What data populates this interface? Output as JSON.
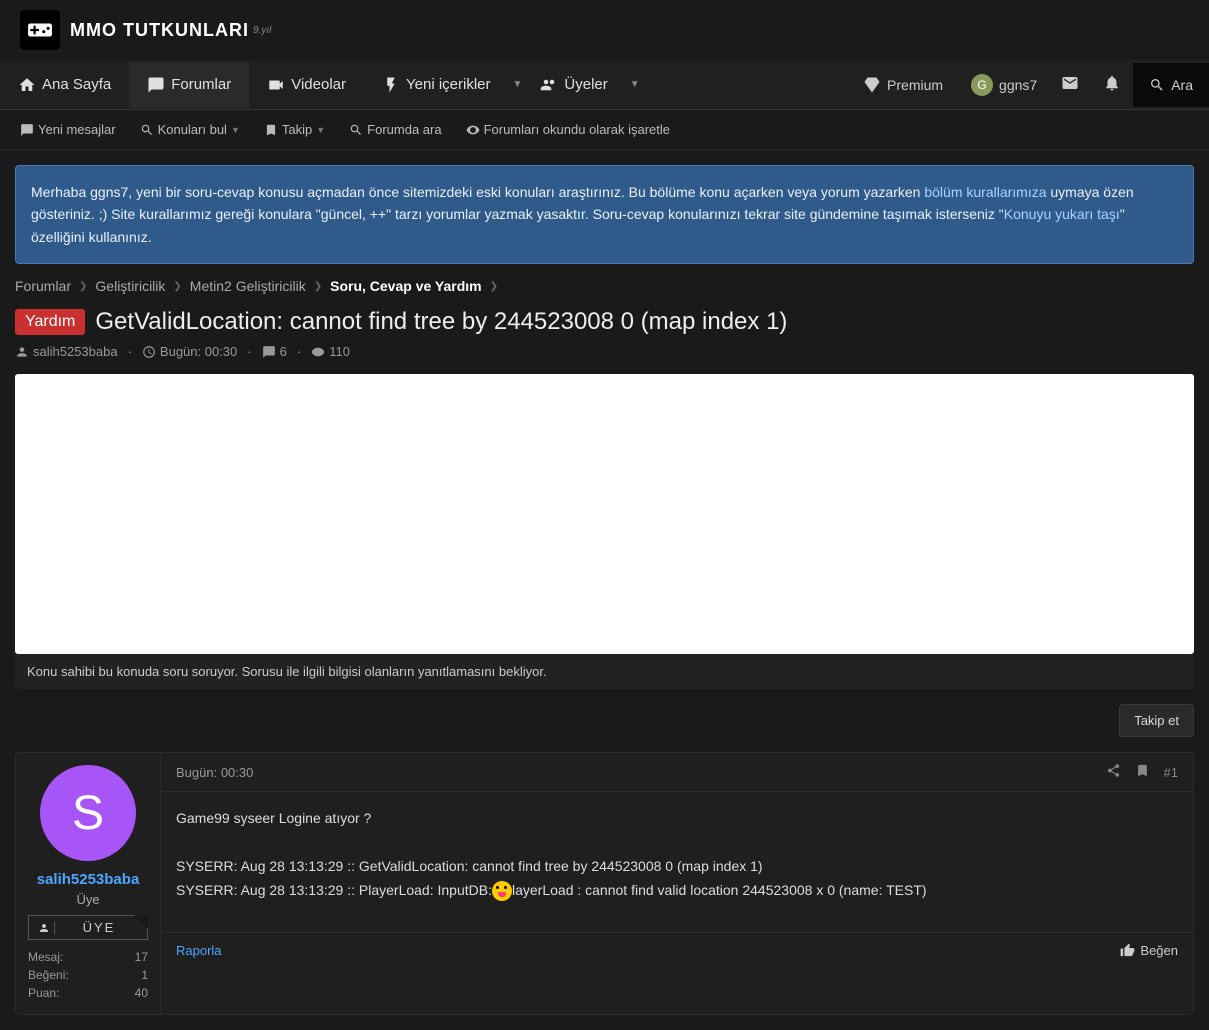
{
  "site": {
    "name": "MMO TUTKUNLARI",
    "year_suffix": "9.yıl"
  },
  "nav": {
    "home": "Ana Sayfa",
    "forums": "Forumlar",
    "videos": "Videolar",
    "new_content": "Yeni içerikler",
    "members": "Üyeler",
    "premium": "Premium",
    "user": "ggns7",
    "user_initial": "G",
    "search": "Ara"
  },
  "subnav": {
    "new_messages": "Yeni mesajlar",
    "find_topics": "Konuları bul",
    "follow": "Takip",
    "search_forum": "Forumda ara",
    "mark_read": "Forumları okundu olarak işaretle"
  },
  "notice": {
    "text1": "Merhaba ggns7, yeni bir soru-cevap konusu açmadan önce sitemizdeki eski konuları araştırınız. Bu bölüme konu açarken veya yorum yazarken ",
    "link1": "bölüm kurallarımıza",
    "text2": " uymaya özen gösteriniz. ;) Site kurallarımız gereği konulara \"güncel, ++\" tarzı yorumlar yazmak yasaktır. Soru-cevap konularınızı tekrar site gündemine taşımak isterseniz \"",
    "link2": "Konuyu yukarı taşı",
    "text3": "\" özelliğini kullanınız."
  },
  "breadcrumb": [
    {
      "label": "Forumlar",
      "active": false
    },
    {
      "label": "Geliştiricilik",
      "active": false
    },
    {
      "label": "Metin2 Geliştiricilik",
      "active": false
    },
    {
      "label": "Soru, Cevap ve Yardım",
      "active": true
    }
  ],
  "thread": {
    "badge": "Yardım",
    "title": "GetValidLocation: cannot find tree by 244523008 0 (map index 1)",
    "author": "salih5253baba",
    "date": "Bugün: 00:30",
    "replies": "6",
    "views": "110"
  },
  "ad_caption": "Konu sahibi bu konuda soru soruyor. Sorusu ile ilgili bilgisi olanların yanıtlamasını bekliyor.",
  "follow_btn": "Takip et",
  "post": {
    "timestamp": "Bugün: 00:30",
    "number": "#1",
    "author": {
      "name": "salih5253baba",
      "initial": "S",
      "role": "Üye",
      "badge": "ÜYE",
      "stats": {
        "mesaj_label": "Mesaj:",
        "mesaj": "17",
        "begeni_label": "Beğeni:",
        "begeni": "1",
        "puan_label": "Puan:",
        "puan": "40"
      }
    },
    "content": {
      "line1": "Game99 syseer Logine atıyor ?",
      "line2": "SYSERR: Aug 28 13:13:29 :: GetValidLocation: cannot find tree by 244523008 0 (map index 1)",
      "line3a": "SYSERR: Aug 28 13:13:29 :: PlayerLoad: InputDB:",
      "line3b": "layerLoad : cannot find valid location 244523008 x 0 (name: TEST)"
    },
    "report": "Raporla",
    "like": "Beğen"
  }
}
